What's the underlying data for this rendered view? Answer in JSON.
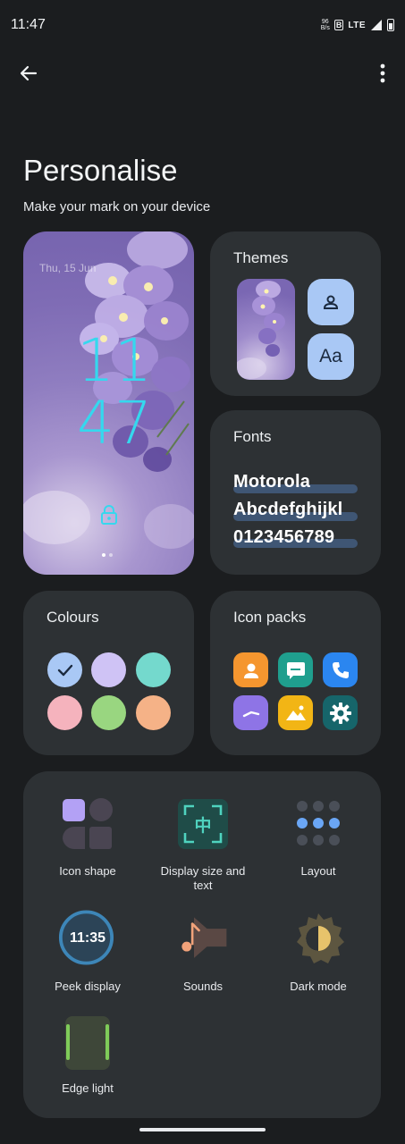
{
  "status": {
    "time": "11:47",
    "speed_value": "96",
    "speed_unit": "B/s",
    "network": "LTE"
  },
  "header": {
    "title": "Personalise",
    "subtitle": "Make your mark on your device"
  },
  "lockscreen": {
    "date": "Thu, 15 Jun",
    "hour": "11",
    "minute": "47"
  },
  "themes": {
    "title": "Themes",
    "aa_label": "Aa"
  },
  "fonts": {
    "title": "Fonts",
    "samples": [
      "Motorola",
      "Abcdefghijkl",
      "0123456789"
    ]
  },
  "colours": {
    "title": "Colours",
    "swatches": [
      "#a9c8f5",
      "#cfc3f5",
      "#74d9cd",
      "#f5b3bd",
      "#99d680",
      "#f5b287"
    ],
    "selected_index": 0
  },
  "icon_packs": {
    "title": "Icon packs"
  },
  "settings": {
    "icon_shape": "Icon shape",
    "display_size": "Display size and text",
    "layout": "Layout",
    "peek_display": "Peek display",
    "peek_time": "11:35",
    "sounds": "Sounds",
    "dark_mode": "Dark mode",
    "edge_light": "Edge light"
  },
  "colors": {
    "background": "#1b1d1f",
    "card": "#2d3134",
    "accent": "#a9c8f5",
    "clock": "#35d8ee"
  }
}
